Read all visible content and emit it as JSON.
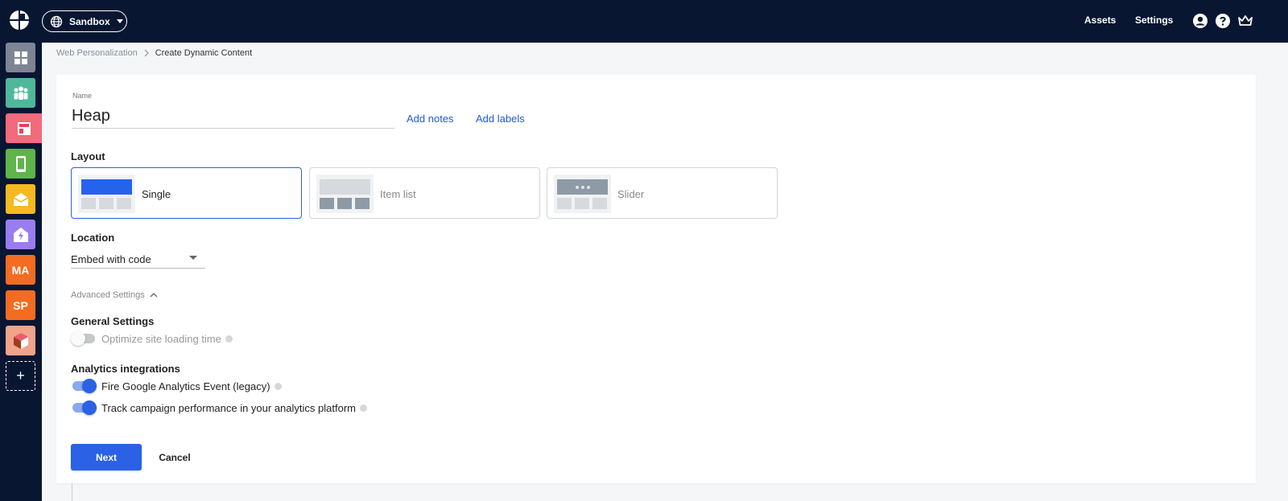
{
  "topbar": {
    "environment": "Sandbox",
    "links": [
      "Assets",
      "Settings"
    ],
    "icons": [
      "account-icon",
      "help-icon",
      "crown-icon"
    ]
  },
  "sidebar": {
    "items": [
      {
        "name": "dashboard",
        "label": "",
        "color": "#7d8594"
      },
      {
        "name": "audience",
        "label": "",
        "color": "#4fb89b"
      },
      {
        "name": "web-personalization",
        "label": "",
        "color": "#f26b7a"
      },
      {
        "name": "mobile",
        "label": "",
        "color": "#5fb54a"
      },
      {
        "name": "email",
        "label": "",
        "color": "#f5b922"
      },
      {
        "name": "email-automation",
        "label": "",
        "color": "#9a7df0"
      },
      {
        "name": "ma",
        "label": "MA",
        "color": "#f36c21"
      },
      {
        "name": "sp",
        "label": "SP",
        "color": "#f36c21"
      },
      {
        "name": "product",
        "label": "",
        "color": "#f0a48a"
      }
    ],
    "add_label": "+"
  },
  "breadcrumb": {
    "parent": "Web Personalization",
    "current": "Create Dynamic Content"
  },
  "form": {
    "name_label": "Name",
    "name_value": "Heap",
    "add_notes": "Add notes",
    "add_labels": "Add labels",
    "layout_title": "Layout",
    "layouts": [
      {
        "label": "Single",
        "selected": true
      },
      {
        "label": "Item list",
        "selected": false
      },
      {
        "label": "Slider",
        "selected": false
      }
    ],
    "location_title": "Location",
    "location_value": "Embed with code",
    "advanced_label": "Advanced Settings",
    "general_title": "General Settings",
    "optimize_label": "Optimize site loading time",
    "optimize_on": false,
    "analytics_title": "Analytics integrations",
    "ga_label": "Fire Google Analytics Event (legacy)",
    "ga_on": true,
    "track_label": "Track campaign performance in your analytics platform",
    "track_on": true
  },
  "actions": {
    "next": "Next",
    "cancel": "Cancel"
  },
  "colors": {
    "nav_bg": "#081632",
    "accent": "#2a61e5",
    "link": "#1f5bd8"
  }
}
